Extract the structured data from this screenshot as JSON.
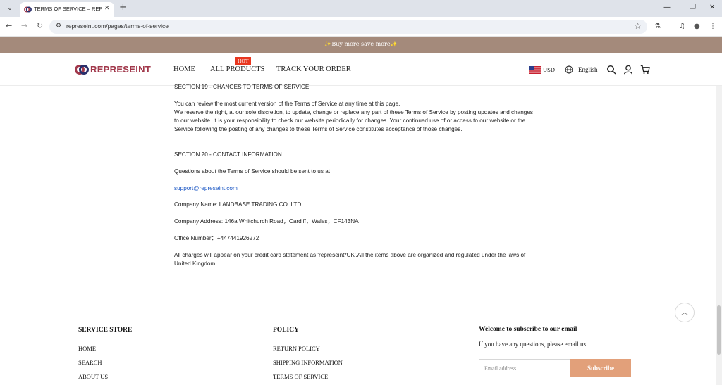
{
  "browser": {
    "tab_title": "TERMS OF SERVICE – REPRESEINT",
    "url": "represeint.com/pages/terms-of-service"
  },
  "announcement": "✨Buy more save more✨",
  "header": {
    "logo_text": "REPRESEINT",
    "nav": [
      "HOME",
      "ALL PRODUCTS",
      "TRACK YOUR ORDER"
    ],
    "hot_badge": "HOT",
    "currency": "USD",
    "language": "English"
  },
  "content": {
    "section19_heading": "SECTION 19 - CHANGES TO TERMS OF SERVICE",
    "section19_p1": "You can review the most current version of the Terms of Service at any time at this page.",
    "section19_p2": "We reserve the right, at our sole discretion, to update, change or replace any part of these Terms of Service by posting updates and changes to our website. It is your responsibility to check our website periodically for changes. Your continued use of or access to our website or the Service following the posting of any changes to these Terms of Service constitutes acceptance of those changes.",
    "section20_heading": "SECTION 20 - CONTACT INFORMATION",
    "questions_text": "Questions about the Terms of Service should be sent to us at",
    "email": "support@represeint.com",
    "company_name": " Company Name: LANDBASE TRADING CO.,LTD",
    "company_address": " Company Address: 146a Whitchurch Road，Cardiff，Wales，CF143NA",
    "office_number": " Office Number：+447441926272",
    "charges_note": "All charges will appear on your credit card statement as  'represeint*UK'.All the items above are organized and regulated under the laws of United Kingdom."
  },
  "footer": {
    "service_store": {
      "heading": "SERVICE STORE",
      "links": [
        "HOME",
        "SEARCH",
        "ABOUT US"
      ]
    },
    "policy": {
      "heading": "POLICY",
      "links": [
        "RETURN POLICY",
        "SHIPPING INFORMATION",
        "TERMS OF SERVICE"
      ]
    },
    "subscribe": {
      "heading": "Welcome to subscribe to our email",
      "text": "If you have any questions, please email us.",
      "placeholder": "Email address",
      "button": "Subscribe"
    }
  },
  "colors": {
    "brand": "#a1384b",
    "announcement_bg": "#a48a7b",
    "hot_badge": "#e8361f",
    "subscribe_button": "#e2a07a",
    "link": "#1a56c4"
  }
}
